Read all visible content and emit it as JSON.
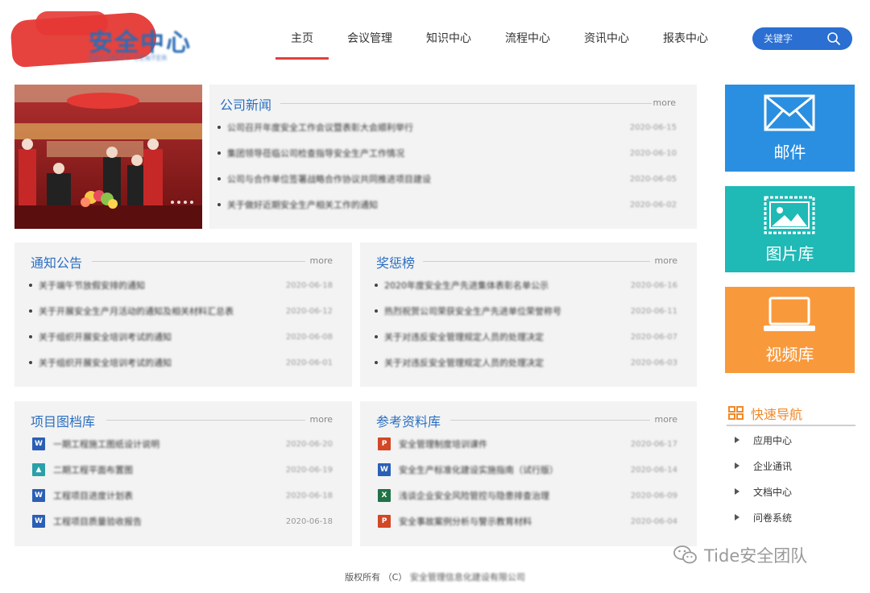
{
  "header": {
    "logo_text": "安全中心",
    "logo_subtext": "SECURITY CENTER"
  },
  "nav": {
    "items": [
      {
        "label": "主页",
        "active": true
      },
      {
        "label": "会议管理"
      },
      {
        "label": "知识中心"
      },
      {
        "label": "流程中心"
      },
      {
        "label": "资讯中心"
      },
      {
        "label": "报表中心"
      }
    ]
  },
  "search": {
    "placeholder": "关键字"
  },
  "company_news": {
    "title": "公司新闻",
    "more": "more",
    "items": [
      {
        "text": "公司召开年度安全工作会议暨表彰大会顺利举行",
        "date": "2020-06-15"
      },
      {
        "text": "集团领导莅临公司检查指导安全生产工作情况",
        "date": "2020-06-10"
      },
      {
        "text": "公司与合作单位签署战略合作协议共同推进项目建设",
        "date": "2020-06-05"
      },
      {
        "text": "关于做好近期安全生产相关工作的通知",
        "date": "2020-06-02"
      }
    ]
  },
  "notices": {
    "title": "通知公告",
    "more": "more",
    "items": [
      {
        "text": "关于端午节放假安排的通知",
        "date": "2020-06-18"
      },
      {
        "text": "关于开展安全生产月活动的通知及相关材料汇总表",
        "date": "2020-06-12"
      },
      {
        "text": "关于组织开展安全培训考试的通知",
        "date": "2020-06-08"
      },
      {
        "text": "关于组织开展安全培训考试的通知",
        "date": "2020-06-01"
      }
    ]
  },
  "rewards": {
    "title": "奖惩榜",
    "more": "more",
    "items": [
      {
        "text": "2020年度安全生产先进集体表彰名单公示",
        "date": "2020-06-16"
      },
      {
        "text": "热烈祝贺公司荣获安全生产先进单位荣誉称号",
        "date": "2020-06-11"
      },
      {
        "text": "关于对违反安全管理规定人员的处理决定",
        "date": "2020-06-07"
      },
      {
        "text": "关于对违反安全管理规定人员的处理决定",
        "date": "2020-06-03"
      }
    ]
  },
  "project_docs": {
    "title": "项目图档库",
    "more": "more",
    "items": [
      {
        "icon": "word",
        "text": "一期工程施工图纸设计说明",
        "date": "2020-06-20"
      },
      {
        "icon": "img",
        "text": "二期工程平面布置图",
        "date": "2020-06-19"
      },
      {
        "icon": "word",
        "text": "工程项目进度计划表",
        "date": "2020-06-18"
      },
      {
        "icon": "word",
        "text": "工程项目质量验收报告",
        "date": "2020-06-18"
      }
    ]
  },
  "references": {
    "title": "参考资料库",
    "more": "more",
    "items": [
      {
        "icon": "ppt",
        "text": "安全管理制度培训课件",
        "date": "2020-06-17"
      },
      {
        "icon": "word",
        "text": "安全生产标准化建设实施指南（试行版）",
        "date": "2020-06-14"
      },
      {
        "icon": "excel",
        "text": "浅谈企业安全风险管控与隐患排查治理",
        "date": "2020-06-09"
      },
      {
        "icon": "ppt",
        "text": "安全事故案例分析与警示教育材料",
        "date": "2020-06-04"
      }
    ]
  },
  "tiles": [
    {
      "label": "邮件",
      "color": "#2a8fe0",
      "icon": "envelope-icon"
    },
    {
      "label": "图片库",
      "color": "#1fb9b6",
      "icon": "picture-icon"
    },
    {
      "label": "视频库",
      "color": "#f89a3c",
      "icon": "laptop-icon"
    }
  ],
  "quick_nav": {
    "title": "快速导航",
    "items": [
      "应用中心",
      "企业通讯",
      "文档中心",
      "问卷系统"
    ]
  },
  "footer": {
    "copyright": "版权所有 （C）",
    "owner": "安全管理信息化建设有限公司"
  },
  "watermark": "Tide安全团队"
}
